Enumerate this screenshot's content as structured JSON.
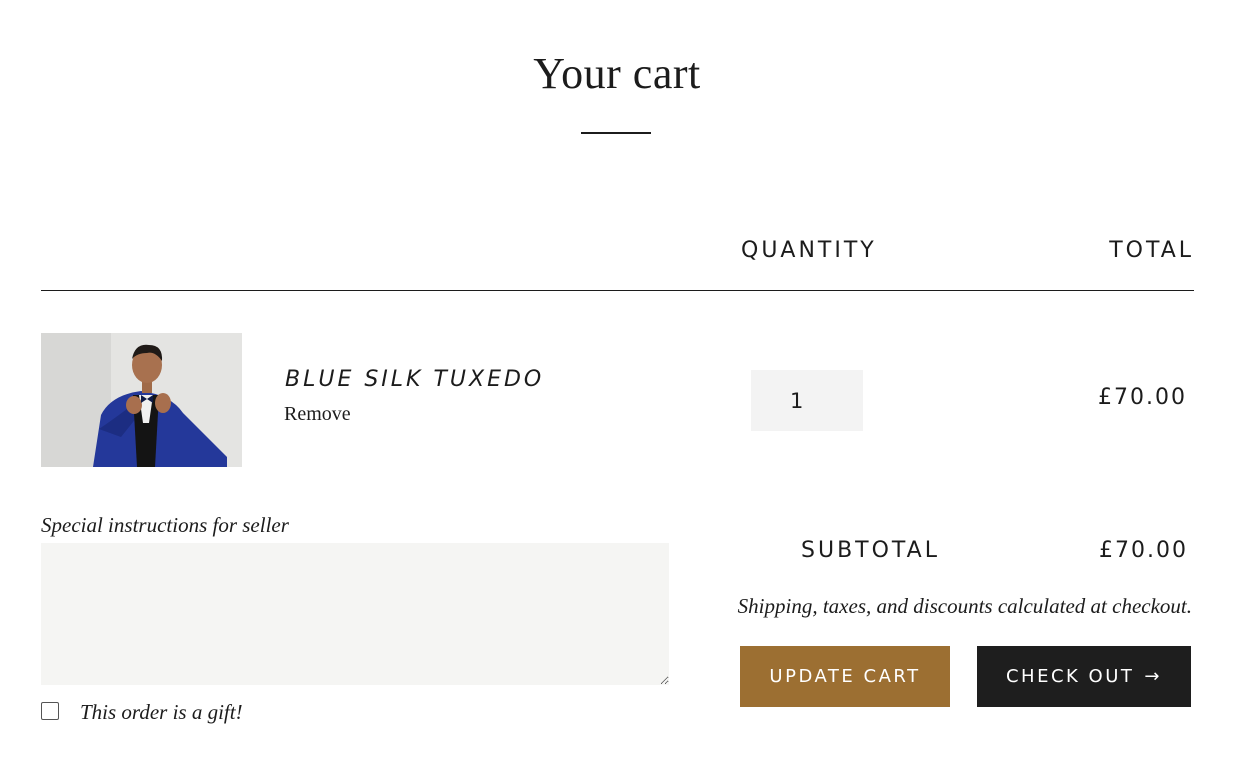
{
  "page": {
    "title": "Your cart"
  },
  "table_header": {
    "quantity": "QUANTITY",
    "total": "TOTAL"
  },
  "cart_items": [
    {
      "name": "BLUE SILK TUXEDO",
      "remove_label": "Remove",
      "quantity": "1",
      "total": "£70.00",
      "image": "man-in-blue-tuxedo-photo"
    }
  ],
  "notes": {
    "label": "Special instructions for seller",
    "value": ""
  },
  "gift": {
    "label": "This order is a gift!",
    "checked": false
  },
  "summary": {
    "subtotal_label": "SUBTOTAL",
    "subtotal_value": "£70.00",
    "shipping_note": "Shipping, taxes, and discounts calculated at checkout."
  },
  "buttons": {
    "update_cart": "UPDATE CART",
    "check_out": "CHECK OUT",
    "check_out_icon": "→"
  },
  "colors": {
    "update_cart_bg": "#9c6f32",
    "check_out_bg": "#1e1e1e",
    "input_bg": "#f3f3f3"
  }
}
